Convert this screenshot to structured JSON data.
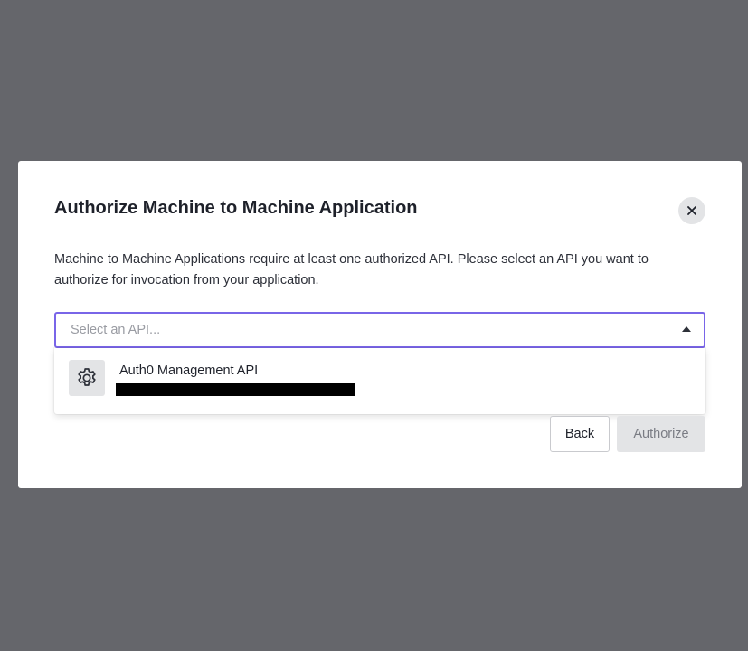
{
  "modal": {
    "title": "Authorize Machine to Machine Application",
    "description": "Machine to Machine Applications require at least one authorized API. Please select an API you want to authorize for invocation from your application.",
    "close_icon": "close-icon"
  },
  "api_select": {
    "placeholder": "Select an API...",
    "value": "",
    "arrow_icon": "caret-up-icon",
    "options": [
      {
        "name": "Auth0 Management API",
        "icon": "gear-icon",
        "identifier_redacted": true
      }
    ]
  },
  "actions": {
    "back_label": "Back",
    "authorize_label": "Authorize",
    "authorize_disabled": true
  },
  "colors": {
    "backdrop": "#65666b",
    "focus_border": "#7965e8",
    "button_disabled_bg": "#e3e4e6"
  }
}
